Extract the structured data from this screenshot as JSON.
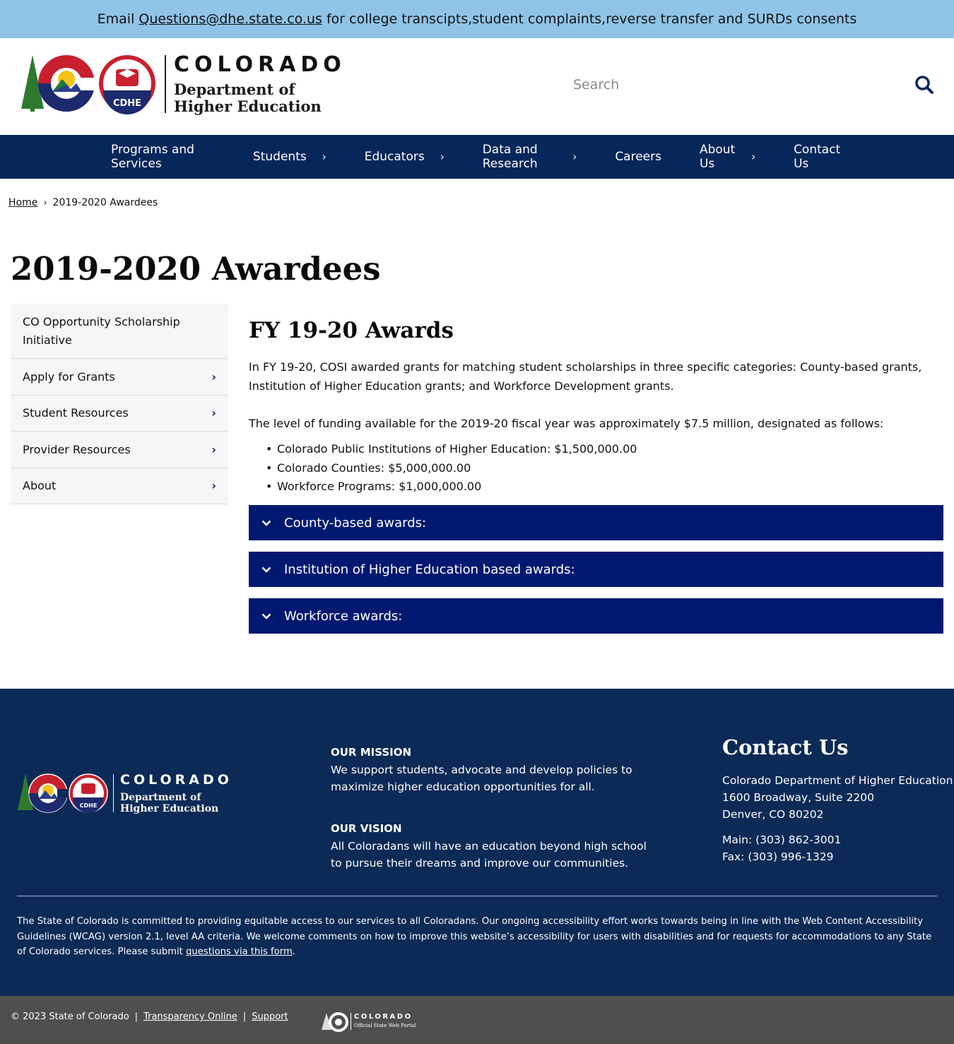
{
  "alert": {
    "prefix": "Email",
    "email": "Questions@dhe.state.co.us",
    "suffix": "for college transcipts,student complaints,reverse transfer and SURDs consents"
  },
  "header": {
    "logo_state": "COLORADO",
    "logo_dept_line1": "Department of",
    "logo_dept_line2": "Higher Education",
    "logo_badge": "CDHE",
    "search_placeholder": "Search"
  },
  "nav": {
    "items": [
      {
        "label": "Programs and Services"
      },
      {
        "label": "Students",
        "chevron": "›"
      },
      {
        "label": "Educators",
        "chevron": "›"
      },
      {
        "label": "Data and Research",
        "chevron": "›"
      },
      {
        "label": "Careers"
      },
      {
        "label": "About Us",
        "chevron": "›"
      },
      {
        "label": "Contact Us"
      }
    ]
  },
  "breadcrumb": {
    "home": "Home",
    "separator": "›",
    "current": "2019-2020 Awardees"
  },
  "page": {
    "title": "2019-2020 Awardees"
  },
  "sidenav": {
    "items": [
      {
        "label": "CO Opportunity Scholarship Initiative"
      },
      {
        "label": "Apply for Grants",
        "chevron": "›"
      },
      {
        "label": "Student Resources",
        "chevron": "›"
      },
      {
        "label": "Provider Resources",
        "chevron": "›"
      },
      {
        "label": "About",
        "chevron": "›"
      }
    ]
  },
  "main": {
    "heading": "FY 19-20 Awards",
    "paragraph1": "In FY 19-20, COSI awarded grants for matching student scholarships in three specific categories: County-based grants, Institution of Higher Education grants; and Workforce Development grants.",
    "paragraph2": "The level of funding available for the 2019-20 fiscal year was approximately $7.5 million, designated as follows:",
    "bullets": [
      "Colorado Public Institutions of Higher Education: $1,500,000.00",
      "Colorado Counties:  $5,000,000.00",
      "Workforce Programs: $1,000,000.00"
    ],
    "accordions": [
      {
        "label": "County-based awards:"
      },
      {
        "label": "Institution of Higher Education based awards:"
      },
      {
        "label": "Workforce awards:"
      }
    ]
  },
  "footer": {
    "logo_state": "COLORADO",
    "logo_dept_line1": "Department of",
    "logo_dept_line2": "Higher Education",
    "logo_badge": "CDHE",
    "mission_title": "OUR MISSION",
    "mission_line1": "We support students, advocate and develop policies to",
    "mission_line2": "maximize higher education opportunities for all.",
    "vision_title": "OUR VISION",
    "vision_line1": "All Coloradans will have an education beyond high school",
    "vision_line2": "to pursue their dreams and improve our communities.",
    "contact_title": "Contact Us",
    "org": "Colorado Department of Higher Education",
    "address1": "1600 Broadway, Suite 2200",
    "address2": "Denver, CO 80202",
    "main_phone": "Main: (303) 862-3001",
    "fax": "Fax: (303) 996-1329",
    "accessibility_text": "The State of Colorado is committed to providing equitable access to our services to all Coloradans. Our ongoing accessibility effort works towards being in line with the Web Content Accessibility Guidelines (WCAG) version 2.1, level AA criteria. We welcome comments on how to improve this website’s accessibility for users with disabilities and for requests for accommodations to any State of Colorado services. Please submit",
    "accessibility_link": "questions via this form",
    "accessibility_end": "."
  },
  "bottom": {
    "copyright": "© 2023 State of Colorado",
    "pipe": "|",
    "transparency": "Transparency Online",
    "support": "Support",
    "portal_state": "COLORADO",
    "portal_sub": "Official State Web Portal"
  },
  "colors": {
    "alert_bg": "#8fc4e6",
    "nav_bg": "#06275a",
    "accordion_bg": "#001970",
    "footer_bg": "#0b2a56",
    "bottom_bg": "#4f4f4f"
  },
  "icons": {
    "search": "search-icon",
    "accordion": "chevron-down-icon",
    "nav": "chevron-right-icon"
  }
}
